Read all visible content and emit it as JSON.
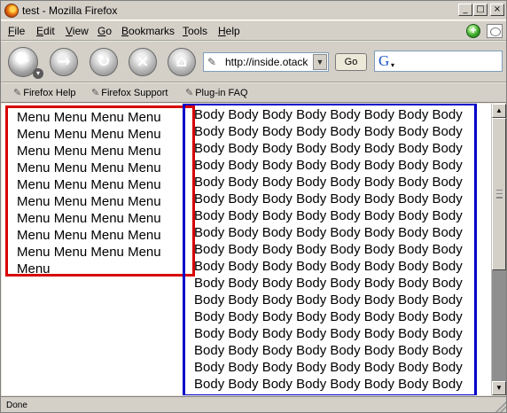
{
  "window": {
    "title": "test - Mozilla Firefox",
    "controls": {
      "minimize": "_",
      "maximize": "□",
      "close": "×"
    }
  },
  "menubar": {
    "items": [
      {
        "accel": "F",
        "rest": "ile"
      },
      {
        "accel": "E",
        "rest": "dit"
      },
      {
        "accel": "V",
        "rest": "iew"
      },
      {
        "accel": "G",
        "rest": "o"
      },
      {
        "accel": "B",
        "rest": "ookmarks"
      },
      {
        "accel": "T",
        "rest": "ools"
      },
      {
        "accel": "H",
        "rest": "elp"
      }
    ]
  },
  "navbar": {
    "back": "←",
    "forward": "→",
    "reload": "↻",
    "stop": "×",
    "home": "⌂",
    "url": "http://inside.otack",
    "go_label": "Go",
    "search_value": ""
  },
  "bookmarks": {
    "items": [
      "Firefox Help",
      "Firefox Support",
      "Plug-in FAQ"
    ]
  },
  "page": {
    "menu_text": "Menu Menu Menu Menu Menu Menu Menu Menu Menu Menu Menu Menu Menu Menu Menu Menu Menu Menu Menu Menu Menu Menu Menu Menu Menu Menu Menu Menu Menu Menu Menu Menu Menu Menu Menu Menu Menu",
    "body_line": "Body Body Body Body Body Body Body Body",
    "body_line_count": 17
  },
  "status": {
    "text": "Done"
  },
  "colors": {
    "menu_border": "#d80000",
    "body_border": "#0000c8"
  },
  "icons": {
    "title": "firefox-logo-icon",
    "status": "update-available-icon",
    "throbber": "throbber-icon",
    "page": "page-icon",
    "search_engine": "google-icon"
  }
}
